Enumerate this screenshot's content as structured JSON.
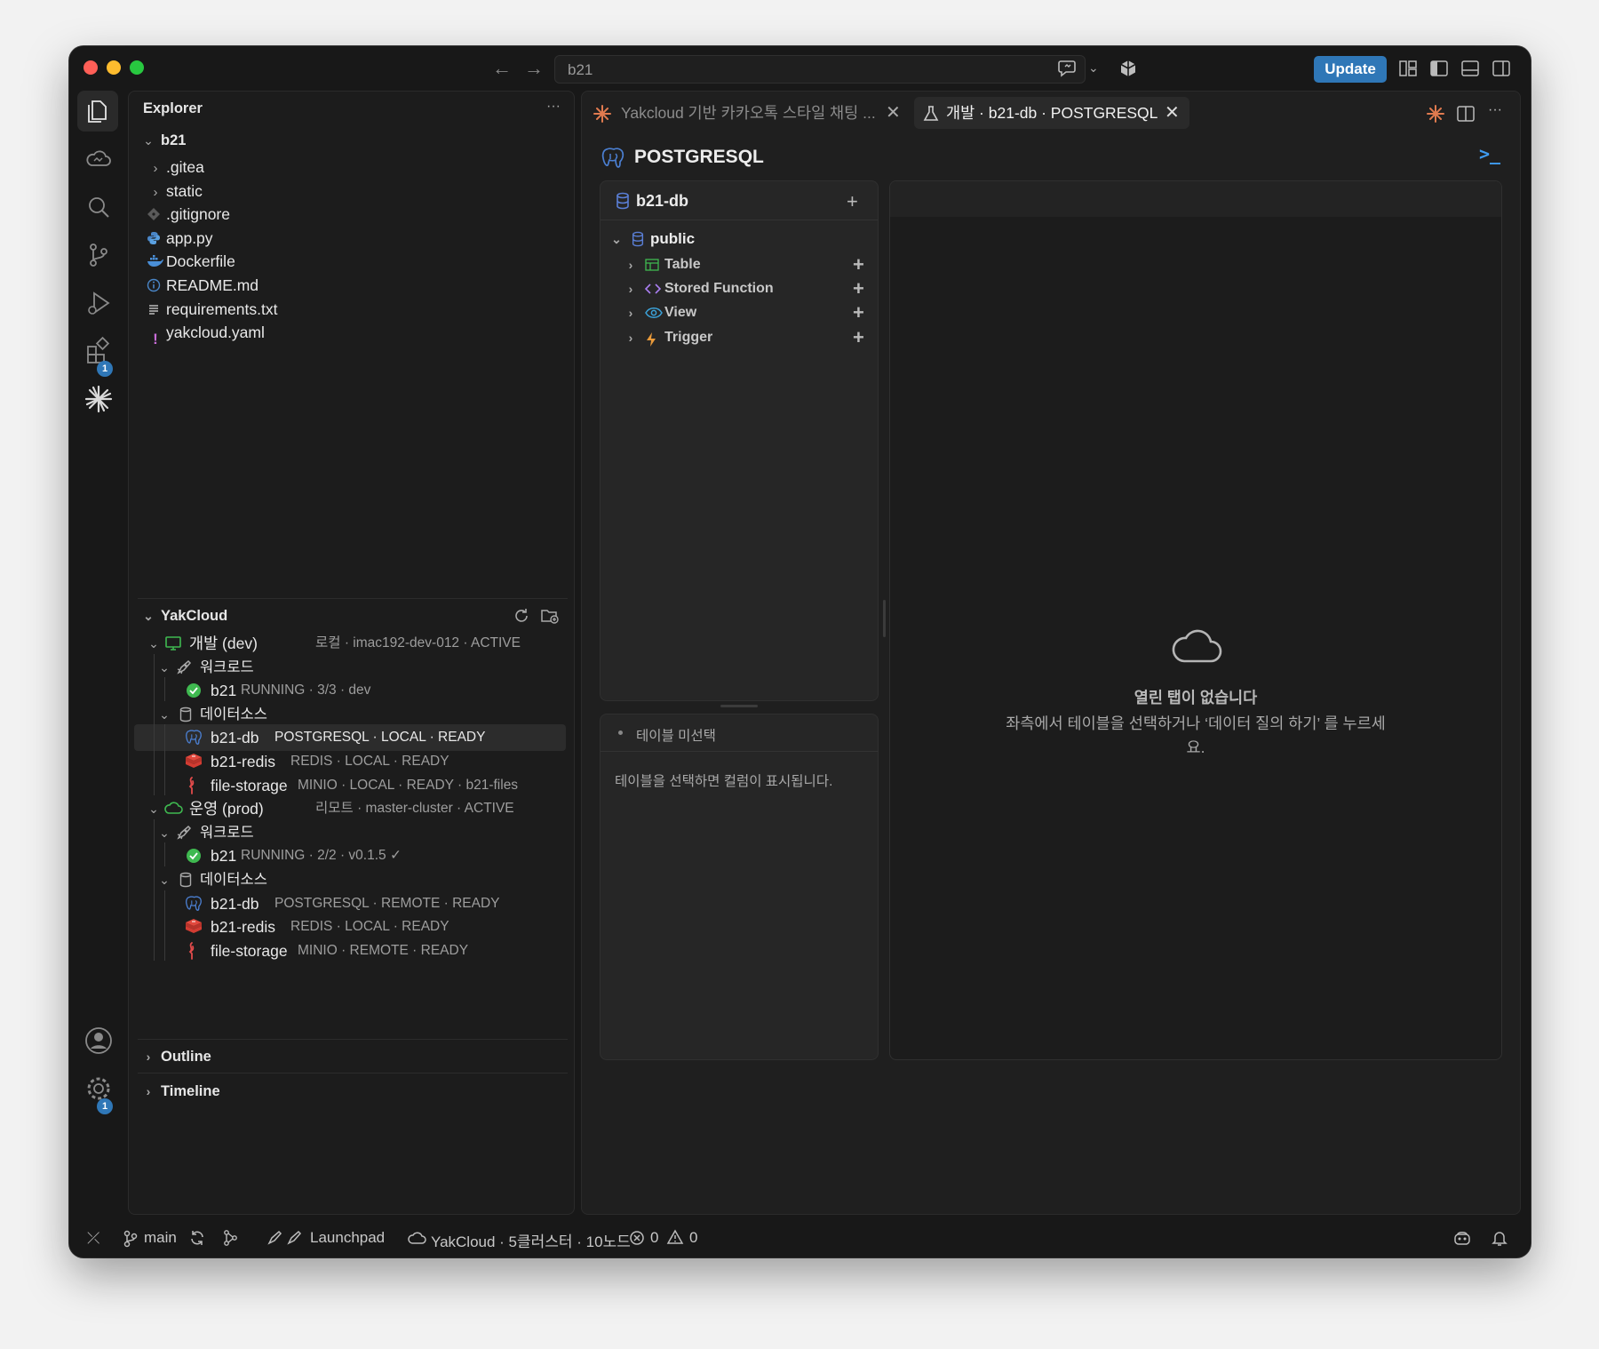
{
  "window": {
    "traffic_colors": [
      "#ff5f57",
      "#febc2e",
      "#28c840"
    ]
  },
  "titlebar": {
    "search_text": "b21",
    "update_label": "Update"
  },
  "activity": {
    "extensions_badge": "1",
    "settings_badge": "1"
  },
  "explorer": {
    "title": "Explorer",
    "more": "···",
    "root": "b21",
    "files": [
      {
        "name": ".gitea",
        "kind": "folder"
      },
      {
        "name": "static",
        "kind": "folder"
      },
      {
        "name": ".gitignore",
        "kind": "git"
      },
      {
        "name": "app.py",
        "kind": "python"
      },
      {
        "name": "Dockerfile",
        "kind": "docker"
      },
      {
        "name": "README.md",
        "kind": "info"
      },
      {
        "name": "requirements.txt",
        "kind": "text"
      },
      {
        "name": "yakcloud.yaml",
        "kind": "yaml"
      }
    ]
  },
  "yakcloud": {
    "title": "YakCloud",
    "envs": [
      {
        "name": "개발 (dev)",
        "meta": "로컬 · imac192-dev-012 · ACTIVE",
        "workload_label": "워크로드",
        "workload": {
          "name": "b21",
          "meta": "RUNNING · 3/3 · dev"
        },
        "ds_label": "데이터소스",
        "datasources": [
          {
            "name": "b21-db",
            "meta": "POSTGRESQL · LOCAL · READY",
            "type": "postgres",
            "selected": true
          },
          {
            "name": "b21-redis",
            "meta": "REDIS · LOCAL · READY",
            "type": "redis"
          },
          {
            "name": "file-storage",
            "meta": "MINIO · LOCAL · READY · b21-files",
            "type": "minio"
          }
        ]
      },
      {
        "name": "운영 (prod)",
        "meta": "리모트 · master-cluster · ACTIVE",
        "workload_label": "워크로드",
        "workload": {
          "name": "b21",
          "meta": "RUNNING · 2/2 · v0.1.5 ✓"
        },
        "ds_label": "데이터소스",
        "datasources": [
          {
            "name": "b21-db",
            "meta": "POSTGRESQL · REMOTE · READY",
            "type": "postgres"
          },
          {
            "name": "b21-redis",
            "meta": "REDIS · LOCAL · READY",
            "type": "redis"
          },
          {
            "name": "file-storage",
            "meta": "MINIO · REMOTE · READY",
            "type": "minio"
          }
        ]
      }
    ]
  },
  "outline_label": "Outline",
  "timeline_label": "Timeline",
  "tabs": [
    {
      "label": "Yakcloud 기반 카카오톡 스타일 채팅 ...",
      "active": false
    },
    {
      "label": "개발 · b21-db · POSTGRESQL",
      "active": true
    }
  ],
  "db": {
    "header": "POSTGRESQL",
    "terminal_glyph": ">_",
    "db_name": "b21-db",
    "schema": "public",
    "items": [
      {
        "label": "Table",
        "icon": "table"
      },
      {
        "label": "Stored Function",
        "icon": "code"
      },
      {
        "label": "View",
        "icon": "eye"
      },
      {
        "label": "Trigger",
        "icon": "bolt"
      }
    ],
    "columns_title": "테이블 미선택",
    "columns_hint": "테이블을 선택하면 컬럼이 표시됩니다.",
    "empty_title": "열린 탭이 없습니다",
    "empty_desc_1": "좌측에서 테이블을 선택하거나 ‘데이터 질의 하기’ 를 누르세",
    "empty_desc_2": "요."
  },
  "status": {
    "branch": "main",
    "launchpad": "Launchpad",
    "yakcloud": "YakCloud · 5클러스터 · 10노드",
    "errors": "0",
    "warnings": "0"
  }
}
